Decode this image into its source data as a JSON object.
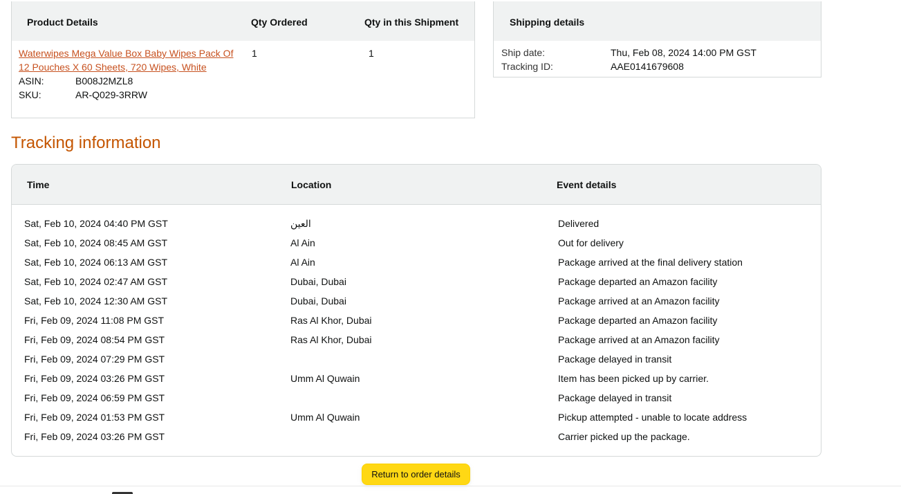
{
  "product_table": {
    "headers": {
      "product": "Product Details",
      "qty_ordered": "Qty Ordered",
      "qty_shipment": "Qty in this Shipment"
    },
    "item": {
      "title_line1": "Waterwipes Mega Value Box Baby Wipes Pack Of",
      "title_line2": "12 Pouches X 60 Sheets, 720 Wipes, White",
      "asin_label": "ASIN:",
      "asin": "B008J2MZL8",
      "sku_label": "SKU:",
      "sku": "AR-Q029-3RRW",
      "qty_ordered": "1",
      "qty_shipment": "1"
    }
  },
  "shipping": {
    "header": "Shipping details",
    "ship_date_label": "Ship date:",
    "ship_date": "Thu, Feb 08, 2024 14:00 PM GST",
    "tracking_label": "Tracking ID:",
    "tracking_id": "AAE0141679608"
  },
  "tracking": {
    "title": "Tracking information",
    "headers": {
      "time": "Time",
      "location": "Location",
      "event": "Event details"
    },
    "rows": [
      {
        "time": "Sat, Feb 10, 2024 04:40 PM GST",
        "location": "العين",
        "event": "Delivered"
      },
      {
        "time": "Sat, Feb 10, 2024 08:45 AM GST",
        "location": "Al Ain",
        "event": "Out for delivery"
      },
      {
        "time": "Sat, Feb 10, 2024 06:13 AM GST",
        "location": "Al Ain",
        "event": "Package arrived at the final delivery station"
      },
      {
        "time": "Sat, Feb 10, 2024 02:47 AM GST",
        "location": "Dubai, Dubai",
        "event": "Package departed an Amazon facility"
      },
      {
        "time": "Sat, Feb 10, 2024 12:30 AM GST",
        "location": "Dubai, Dubai",
        "event": "Package arrived at an Amazon facility"
      },
      {
        "time": "Fri, Feb 09, 2024 11:08 PM GST",
        "location": "Ras Al Khor, Dubai",
        "event": "Package departed an Amazon facility"
      },
      {
        "time": "Fri, Feb 09, 2024 08:54 PM GST",
        "location": "Ras Al Khor, Dubai",
        "event": "Package arrived at an Amazon facility"
      },
      {
        "time": "Fri, Feb 09, 2024 07:29 PM GST",
        "location": "",
        "event": "Package delayed in transit"
      },
      {
        "time": "Fri, Feb 09, 2024 03:26 PM GST",
        "location": "Umm Al Quwain",
        "event": "Item has been picked up by carrier."
      },
      {
        "time": "Fri, Feb 09, 2024 06:59 PM GST",
        "location": "",
        "event": "Package delayed in transit"
      },
      {
        "time": "Fri, Feb 09, 2024 01:53 PM GST",
        "location": "Umm Al Quwain",
        "event": "Pickup attempted - unable to locate address"
      },
      {
        "time": "Fri, Feb 09, 2024 03:26 PM GST",
        "location": "",
        "event": "Carrier picked up the package."
      }
    ]
  },
  "actions": {
    "return_label": "Return to order details"
  },
  "colors": {
    "accent_link": "#c7511f",
    "title": "#c45500",
    "button": "#ffd814",
    "header_bg": "#f0f2f2"
  }
}
